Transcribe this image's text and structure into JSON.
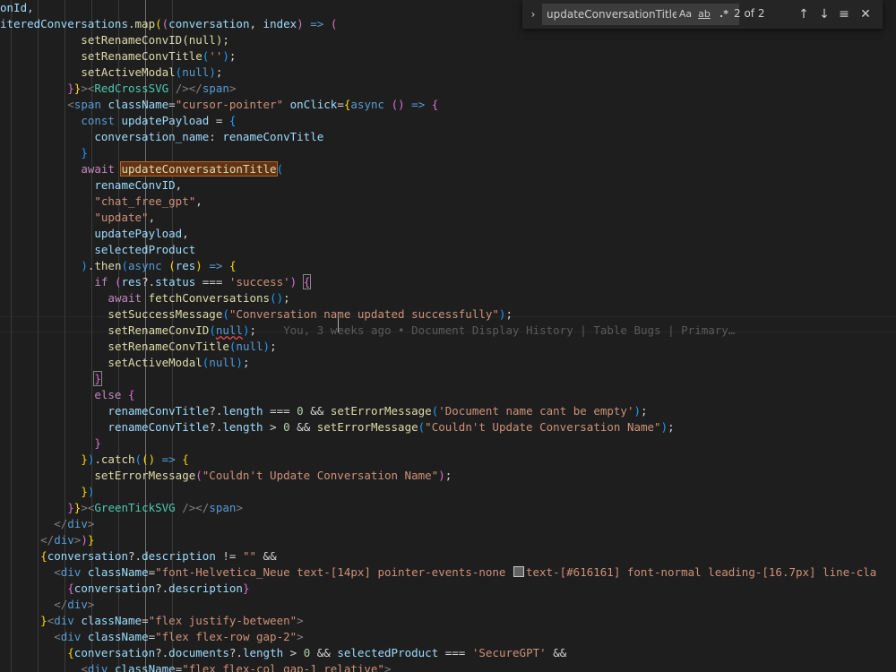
{
  "find_widget": {
    "query": "updateConversationTitle",
    "match_case_label": "Aa",
    "whole_word_label": "ab",
    "regex_label": ".*",
    "match_count": "2 of 2",
    "toggle_icon": "chevron-right-icon",
    "prev_icon": "arrow-up-icon",
    "next_icon": "arrow-down-icon",
    "selection_icon": "find-in-selection-icon",
    "close_icon": "close-icon"
  },
  "editor": {
    "blame": "You, 3 weeks ago • Document Display History | Table Bugs | Primary…",
    "lines": [
      [
        [
          "onId,",
          "var"
        ]
      ],
      [
        [
          "iteredConversations",
          "var"
        ],
        [
          ".",
          "pl"
        ],
        [
          "map",
          "fn"
        ],
        [
          "(",
          "br1"
        ],
        [
          "(",
          "br2"
        ],
        [
          "conversation",
          "var"
        ],
        [
          ", ",
          "pl"
        ],
        [
          "index",
          "var"
        ],
        [
          ")",
          "br2"
        ],
        [
          " ",
          "pl"
        ],
        [
          "=>",
          "kw"
        ],
        [
          " (",
          "br2"
        ]
      ],
      [
        [
          "            setRenameConvID(null);",
          "fn"
        ]
      ],
      [
        [
          "            ",
          "pl"
        ],
        [
          "setRenameConvTitle",
          "fn"
        ],
        [
          "(",
          "br3"
        ],
        [
          "''",
          "str"
        ],
        [
          ")",
          "br3"
        ],
        [
          ";",
          "pl"
        ]
      ],
      [
        [
          "            ",
          "pl"
        ],
        [
          "setActiveModal",
          "fn"
        ],
        [
          "(",
          "br3"
        ],
        [
          "null",
          "kw"
        ],
        [
          ")",
          "br3"
        ],
        [
          ";",
          "pl"
        ]
      ],
      [
        [
          "          ",
          "pl"
        ],
        [
          "}",
          "br2"
        ],
        [
          "}",
          "br1"
        ],
        [
          ">",
          "gray"
        ],
        [
          "<",
          "gray"
        ],
        [
          "RedCrossSVG",
          "comp"
        ],
        [
          " />",
          "gray"
        ],
        [
          "</",
          "gray"
        ],
        [
          "span",
          "tag"
        ],
        [
          ">",
          "gray"
        ]
      ],
      [
        [
          "          ",
          "pl"
        ],
        [
          "<",
          "gray"
        ],
        [
          "span",
          "tag"
        ],
        [
          " ",
          "pl"
        ],
        [
          "className",
          "attr"
        ],
        [
          "=",
          "pl"
        ],
        [
          "\"cursor-pointer\"",
          "str"
        ],
        [
          " ",
          "pl"
        ],
        [
          "onClick",
          "attr"
        ],
        [
          "=",
          "pl"
        ],
        [
          "{",
          "br1"
        ],
        [
          "async",
          "kw"
        ],
        [
          " ",
          "pl"
        ],
        [
          "(",
          "br2"
        ],
        [
          ")",
          "br2"
        ],
        [
          " ",
          "pl"
        ],
        [
          "=>",
          "kw"
        ],
        [
          " ",
          "pl"
        ],
        [
          "{",
          "br2"
        ]
      ],
      [
        [
          "            ",
          "pl"
        ],
        [
          "const",
          "kw"
        ],
        [
          " ",
          "pl"
        ],
        [
          "updatePayload",
          "var"
        ],
        [
          " = ",
          "pl"
        ],
        [
          "{",
          "br3"
        ]
      ],
      [
        [
          "              ",
          "pl"
        ],
        [
          "conversation_name",
          "var"
        ],
        [
          ": ",
          "pl"
        ],
        [
          "renameConvTitle",
          "var"
        ]
      ],
      [
        [
          "            ",
          "pl"
        ],
        [
          "}",
          "br3"
        ]
      ],
      [
        [
          "            ",
          "pl"
        ],
        [
          "await",
          "ctl"
        ],
        [
          " ",
          "pl"
        ],
        [
          "updateConversationTitle",
          "fn match"
        ],
        [
          "(",
          "br3"
        ]
      ],
      [
        [
          "              ",
          "pl"
        ],
        [
          "renameConvID",
          "var"
        ],
        [
          ",",
          "pl"
        ]
      ],
      [
        [
          "              ",
          "pl"
        ],
        [
          "\"chat_free_gpt\"",
          "str"
        ],
        [
          ",",
          "pl"
        ]
      ],
      [
        [
          "              ",
          "pl"
        ],
        [
          "\"update\"",
          "str"
        ],
        [
          ",",
          "pl"
        ]
      ],
      [
        [
          "              ",
          "pl"
        ],
        [
          "updatePayload",
          "var"
        ],
        [
          ",",
          "pl"
        ]
      ],
      [
        [
          "              ",
          "pl"
        ],
        [
          "selectedProduct",
          "var"
        ]
      ],
      [
        [
          "            ",
          "pl"
        ],
        [
          ")",
          "br3"
        ],
        [
          ".",
          "pl"
        ],
        [
          "then",
          "fn"
        ],
        [
          "(",
          "br3"
        ],
        [
          "async",
          "kw"
        ],
        [
          " ",
          "pl"
        ],
        [
          "(",
          "br1"
        ],
        [
          "res",
          "var"
        ],
        [
          ")",
          "br1"
        ],
        [
          " ",
          "pl"
        ],
        [
          "=>",
          "kw"
        ],
        [
          " ",
          "pl"
        ],
        [
          "{",
          "br1"
        ]
      ],
      [
        [
          "              ",
          "pl"
        ],
        [
          "if",
          "ctl"
        ],
        [
          " ",
          "pl"
        ],
        [
          "(",
          "br2"
        ],
        [
          "res",
          "var"
        ],
        [
          "?.",
          "pl"
        ],
        [
          "status",
          "var"
        ],
        [
          " === ",
          "pl"
        ],
        [
          "'success'",
          "str"
        ],
        [
          ")",
          "br2"
        ],
        [
          " ",
          "pl"
        ],
        [
          "{",
          "br2 bracket-box"
        ]
      ],
      [
        [
          "                ",
          "pl"
        ],
        [
          "await",
          "ctl"
        ],
        [
          " ",
          "pl"
        ],
        [
          "fetchConversations",
          "fn"
        ],
        [
          "(",
          "br3"
        ],
        [
          ")",
          "br3"
        ],
        [
          ";",
          "pl"
        ]
      ],
      [
        [
          "                ",
          "pl"
        ],
        [
          "setSuccessMessage",
          "fn"
        ],
        [
          "(",
          "br3"
        ],
        [
          "\"Conversation name updated successfully\"",
          "str"
        ],
        [
          ")",
          "br3"
        ],
        [
          ";",
          "pl"
        ]
      ],
      [
        [
          "                ",
          "pl"
        ],
        [
          "setRenameConvID",
          "fn"
        ],
        [
          "(",
          "br3"
        ],
        [
          "null",
          "kw squiggle"
        ],
        [
          ")",
          "br3"
        ],
        [
          ";",
          "pl"
        ],
        [
          "    ",
          "pl"
        ],
        [
          "__BLAME__",
          "blame"
        ]
      ],
      [
        [
          "                ",
          "pl"
        ],
        [
          "setRenameConvTitle",
          "fn"
        ],
        [
          "(",
          "br3"
        ],
        [
          "null",
          "kw"
        ],
        [
          ")",
          "br3"
        ],
        [
          ";",
          "pl"
        ]
      ],
      [
        [
          "                ",
          "pl"
        ],
        [
          "setActiveModal",
          "fn"
        ],
        [
          "(",
          "br3"
        ],
        [
          "null",
          "kw"
        ],
        [
          ")",
          "br3"
        ],
        [
          ";",
          "pl"
        ]
      ],
      [
        [
          "              ",
          "pl"
        ],
        [
          "}",
          "br2 bracket-box"
        ]
      ],
      [
        [
          "              ",
          "pl"
        ],
        [
          "else",
          "ctl"
        ],
        [
          " ",
          "pl"
        ],
        [
          "{",
          "br2"
        ]
      ],
      [
        [
          "                ",
          "pl"
        ],
        [
          "renameConvTitle",
          "var"
        ],
        [
          "?.",
          "pl"
        ],
        [
          "length",
          "var"
        ],
        [
          " === ",
          "pl"
        ],
        [
          "0",
          "num"
        ],
        [
          " && ",
          "pl"
        ],
        [
          "setErrorMessage",
          "fn"
        ],
        [
          "(",
          "br3"
        ],
        [
          "'Document name cant be empty'",
          "str"
        ],
        [
          ")",
          "br3"
        ],
        [
          ";",
          "pl"
        ]
      ],
      [
        [
          "                ",
          "pl"
        ],
        [
          "renameConvTitle",
          "var"
        ],
        [
          "?.",
          "pl"
        ],
        [
          "length",
          "var"
        ],
        [
          " > ",
          "pl"
        ],
        [
          "0",
          "num"
        ],
        [
          " && ",
          "pl"
        ],
        [
          "setErrorMessage",
          "fn"
        ],
        [
          "(",
          "br3"
        ],
        [
          "\"Couldn't Update Conversation Name\"",
          "str"
        ],
        [
          ")",
          "br3"
        ],
        [
          ";",
          "pl"
        ]
      ],
      [
        [
          "              ",
          "pl"
        ],
        [
          "}",
          "br2"
        ]
      ],
      [
        [
          "            ",
          "pl"
        ],
        [
          "}",
          "br1"
        ],
        [
          ")",
          "br3"
        ],
        [
          ".",
          "pl"
        ],
        [
          "catch",
          "fn"
        ],
        [
          "(",
          "br3"
        ],
        [
          "(",
          "br1"
        ],
        [
          ")",
          "br1"
        ],
        [
          " ",
          "pl"
        ],
        [
          "=>",
          "kw"
        ],
        [
          " ",
          "pl"
        ],
        [
          "{",
          "br1"
        ]
      ],
      [
        [
          "              ",
          "pl"
        ],
        [
          "setErrorMessage",
          "fn"
        ],
        [
          "(",
          "br2"
        ],
        [
          "\"Couldn't Update Conversation Name\"",
          "str"
        ],
        [
          ")",
          "br2"
        ],
        [
          ";",
          "pl"
        ]
      ],
      [
        [
          "            ",
          "pl"
        ],
        [
          "}",
          "br1"
        ],
        [
          ")",
          "br3"
        ]
      ],
      [
        [
          "          ",
          "pl"
        ],
        [
          "}",
          "br2"
        ],
        [
          "}",
          "br1"
        ],
        [
          ">",
          "gray"
        ],
        [
          "<",
          "gray"
        ],
        [
          "GreenTickSVG",
          "comp"
        ],
        [
          " />",
          "gray"
        ],
        [
          "</",
          "gray"
        ],
        [
          "span",
          "tag"
        ],
        [
          ">",
          "gray"
        ]
      ],
      [
        [
          "        ",
          "pl"
        ],
        [
          "</",
          "gray"
        ],
        [
          "div",
          "tag"
        ],
        [
          ">",
          "gray"
        ]
      ],
      [
        [
          "      ",
          "pl"
        ],
        [
          "</",
          "gray"
        ],
        [
          "div",
          "tag"
        ],
        [
          ">",
          "gray"
        ],
        [
          ")",
          "br2"
        ],
        [
          "}",
          "br1"
        ]
      ],
      [
        [
          "      ",
          "pl"
        ],
        [
          "{",
          "br1"
        ],
        [
          "conversation",
          "var"
        ],
        [
          "?.",
          "pl"
        ],
        [
          "description",
          "var"
        ],
        [
          " != ",
          "pl"
        ],
        [
          "\"\"",
          "str"
        ],
        [
          " &&",
          "pl"
        ]
      ],
      [
        [
          "        ",
          "pl"
        ],
        [
          "<",
          "gray"
        ],
        [
          "div",
          "tag"
        ],
        [
          " ",
          "pl"
        ],
        [
          "className",
          "attr"
        ],
        [
          "=",
          "pl"
        ],
        [
          "\"font-Helvetica_Neue text-[14px] pointer-events-none ",
          "str"
        ],
        [
          "__SWATCH__",
          "swatch"
        ],
        [
          "text-[#616161] font-normal leading-[16.7px] line-cla",
          "str"
        ]
      ],
      [
        [
          "          ",
          "pl"
        ],
        [
          "{",
          "br2"
        ],
        [
          "conversation",
          "var"
        ],
        [
          "?.",
          "pl"
        ],
        [
          "description",
          "var"
        ],
        [
          "}",
          "br2"
        ]
      ],
      [
        [
          "        ",
          "pl"
        ],
        [
          "</",
          "gray"
        ],
        [
          "div",
          "tag"
        ],
        [
          ">",
          "gray"
        ]
      ],
      [
        [
          "      ",
          "pl"
        ],
        [
          "}",
          "br1"
        ],
        [
          "<",
          "gray"
        ],
        [
          "div",
          "tag"
        ],
        [
          " ",
          "pl"
        ],
        [
          "className",
          "attr"
        ],
        [
          "=",
          "pl"
        ],
        [
          "\"flex justify-between\"",
          "str"
        ],
        [
          ">",
          "gray"
        ]
      ],
      [
        [
          "        ",
          "pl"
        ],
        [
          "<",
          "gray"
        ],
        [
          "div",
          "tag"
        ],
        [
          " ",
          "pl"
        ],
        [
          "className",
          "attr"
        ],
        [
          "=",
          "pl"
        ],
        [
          "\"flex flex-row gap-2\"",
          "str"
        ],
        [
          ">",
          "gray"
        ]
      ],
      [
        [
          "          ",
          "pl"
        ],
        [
          "{",
          "br1"
        ],
        [
          "conversation",
          "var"
        ],
        [
          "?.",
          "pl"
        ],
        [
          "documents",
          "var"
        ],
        [
          "?.",
          "pl"
        ],
        [
          "length",
          "var"
        ],
        [
          " > ",
          "pl"
        ],
        [
          "0",
          "num"
        ],
        [
          " && ",
          "pl"
        ],
        [
          "selectedProduct",
          "var"
        ],
        [
          " === ",
          "pl"
        ],
        [
          "'SecureGPT'",
          "str"
        ],
        [
          " &&",
          "pl"
        ]
      ],
      [
        [
          "            ",
          "pl"
        ],
        [
          "<",
          "gray"
        ],
        [
          "div",
          "tag"
        ],
        [
          " ",
          "pl"
        ],
        [
          "className",
          "attr"
        ],
        [
          "=",
          "pl"
        ],
        [
          "\"flex flex-col gap-1 relative\"",
          "str"
        ],
        [
          ">",
          "gray"
        ]
      ]
    ]
  }
}
